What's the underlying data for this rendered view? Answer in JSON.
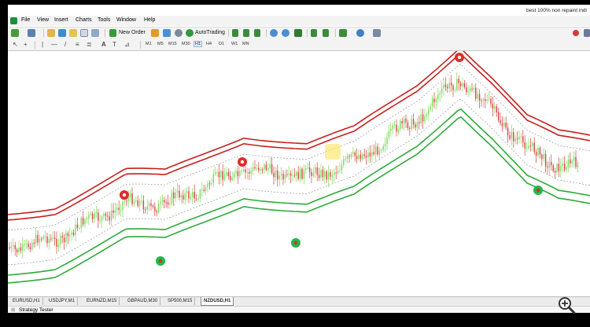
{
  "window": {
    "caption": "best 100% non repaint indi"
  },
  "menu": [
    "File",
    "View",
    "Insert",
    "Charts",
    "Tools",
    "Window",
    "Help"
  ],
  "toolbar": {
    "new_order": "New Order",
    "auto_trading": "AutoTrading"
  },
  "timeframes": [
    "M1",
    "M5",
    "M15",
    "M30",
    "H1",
    "H4",
    "D1",
    "W1",
    "MN"
  ],
  "active_timeframe": "H1",
  "chart": {
    "symbol": "NZDUSD",
    "timeframe": "H1",
    "upper_band_color": "#c8201e",
    "lower_band_color": "#2faa3b",
    "up_candle_color": "#7ed957",
    "down_candle_color": "#d64040"
  },
  "tabs": [
    "EURUSD,H1",
    "USDJPY,M1",
    "EURNZD,M15",
    "GBPAUD,M30",
    "SP500,M15",
    "NZDUSD,H1"
  ],
  "active_tab": "NZDUSD,H1",
  "status": {
    "strategy_tester": "Strategy Tester"
  },
  "icons": {
    "zoom": "magnifier-plus-icon"
  }
}
